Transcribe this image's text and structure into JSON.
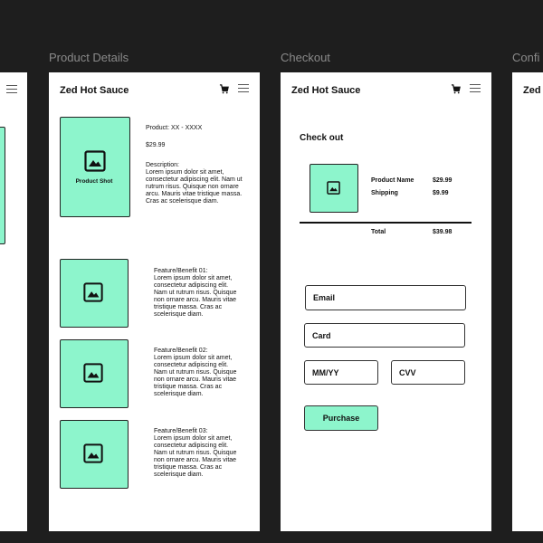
{
  "frames": {
    "product_details_label": "Product Details",
    "checkout_label": "Checkout",
    "confirmation_label": "Confi"
  },
  "brand": {
    "name": "Zed Hot Sauce",
    "partial_name": "Zed I"
  },
  "product": {
    "image_caption": "Product Shot",
    "id_line": "Product: XX - XXXX",
    "price": "$29.99",
    "description_label": "Description:",
    "description_text": "Lorem ipsum dolor sit amet, consectetur adipiscing elit. Nam ut rutrum risus. Quisque non ornare arcu. Mauris vitae tristique massa. Cras ac scelerisque diam."
  },
  "features": [
    {
      "label": "Feature/Benefit 01:",
      "text": "Lorem ipsum dolor sit amet, consectetur adipiscing elit. Nam ut rutrum risus. Quisque non ornare arcu. Mauris vitae tristique massa. Cras ac scelerisque diam."
    },
    {
      "label": "Feature/Benefit 02:",
      "text": "Lorem ipsum dolor sit amet, consectetur adipiscing elit. Nam ut rutrum risus. Quisque non ornare arcu. Mauris vitae tristique massa. Cras ac scelerisque diam."
    },
    {
      "label": "Feature/Benefit 03:",
      "text": "Lorem ipsum dolor sit amet, consectetur adipiscing elit. Nam ut rutrum risus. Quisque non ornare arcu. Mauris vitae tristique massa. Cras ac scelerisque diam."
    }
  ],
  "checkout": {
    "title": "Check out",
    "product_name_label": "Product Name",
    "product_price": "$29.99",
    "shipping_label": "Shipping",
    "shipping_price": "$9.99",
    "total_label": "Total",
    "total_price": "$39.98",
    "email_label": "Email",
    "card_label": "Card",
    "expiry_label": "MM/YY",
    "cvv_label": "CVV",
    "purchase_label": "Purchase"
  },
  "colors": {
    "canvas": "#1e1e1e",
    "accent_mint": "#8df5cc",
    "frame": "#ffffff"
  },
  "icons": [
    "cart-icon",
    "menu-icon",
    "image-placeholder-icon"
  ]
}
